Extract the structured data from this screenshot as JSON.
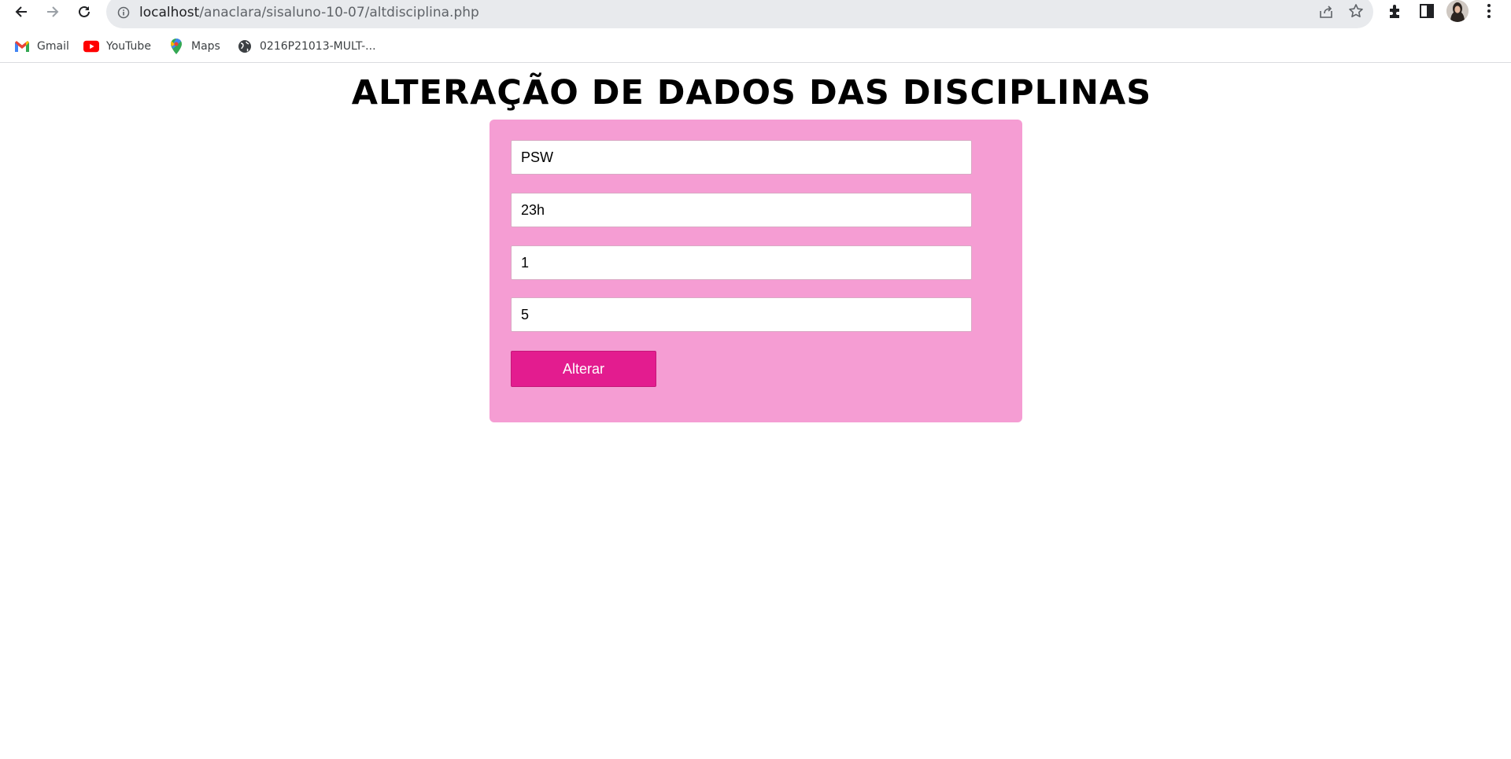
{
  "browser": {
    "url_host": "localhost",
    "url_path": "/anaclara/sisaluno-10-07/altdisciplina.php",
    "bookmarks": [
      {
        "label": "Gmail",
        "icon": "gmail-icon"
      },
      {
        "label": "YouTube",
        "icon": "youtube-icon"
      },
      {
        "label": "Maps",
        "icon": "maps-icon"
      },
      {
        "label": "0216P21013-MULT-...",
        "icon": "globe-icon"
      }
    ]
  },
  "page": {
    "title": "ALTERAÇÃO DE DADOS DAS DISCIPLINAS",
    "fields": [
      {
        "value": "PSW"
      },
      {
        "value": "23h"
      },
      {
        "value": "1"
      },
      {
        "value": "5"
      }
    ],
    "submit_label": "Alterar"
  },
  "colors": {
    "card_background": "#f59dd3",
    "button_background": "#e31c8f"
  }
}
